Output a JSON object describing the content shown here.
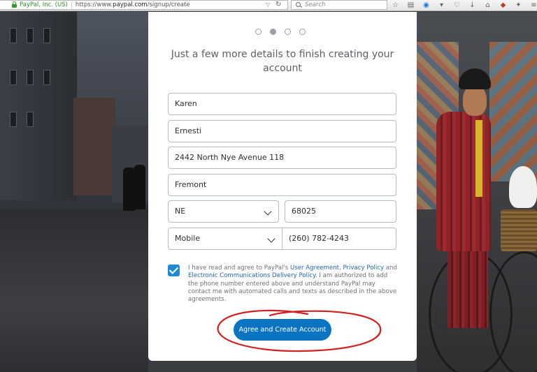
{
  "browser": {
    "identity": "PayPal, Inc. (US)",
    "url_prefix": "https://www.",
    "url_domain": "paypal.com",
    "url_path": "/signup/create",
    "search_placeholder": "Search",
    "toolbar_icons": [
      "star-icon",
      "reading-list-icon",
      "history-icon",
      "dropdown-icon",
      "pocket-icon",
      "download-icon",
      "home-icon",
      "extension-icon",
      "addon-icon",
      "menu-icon"
    ]
  },
  "signup": {
    "step_indicator": {
      "total": 4,
      "current": 2
    },
    "heading": "Just a few more details to finish creating your account",
    "first_name": "Karen",
    "last_name": "Ernesti",
    "street": "2442 North Nye Avenue 118",
    "city": "Fremont",
    "state": "NE",
    "zip": "68025",
    "phone_type": "Mobile",
    "phone": "(260) 782-4243",
    "consent_checked": true,
    "terms": {
      "intro": "I have read and agree to PayPal's ",
      "user_agreement": "User Agreement",
      "comma": ", ",
      "privacy_policy": "Privacy Policy",
      "and": " and ",
      "ecd_policy": "Electronic Communications Delivery Policy",
      "rest": ". I am authorized to add the phone number entered above and understand PayPal may contact me with automated calls and texts as described in the above agreements."
    },
    "submit_label": "Agree and Create Account"
  },
  "colors": {
    "brand_button": "#0b74c2",
    "link": "#1f66b5",
    "checkbox": "#1e8ad6",
    "annotation": "#d21f1f"
  }
}
